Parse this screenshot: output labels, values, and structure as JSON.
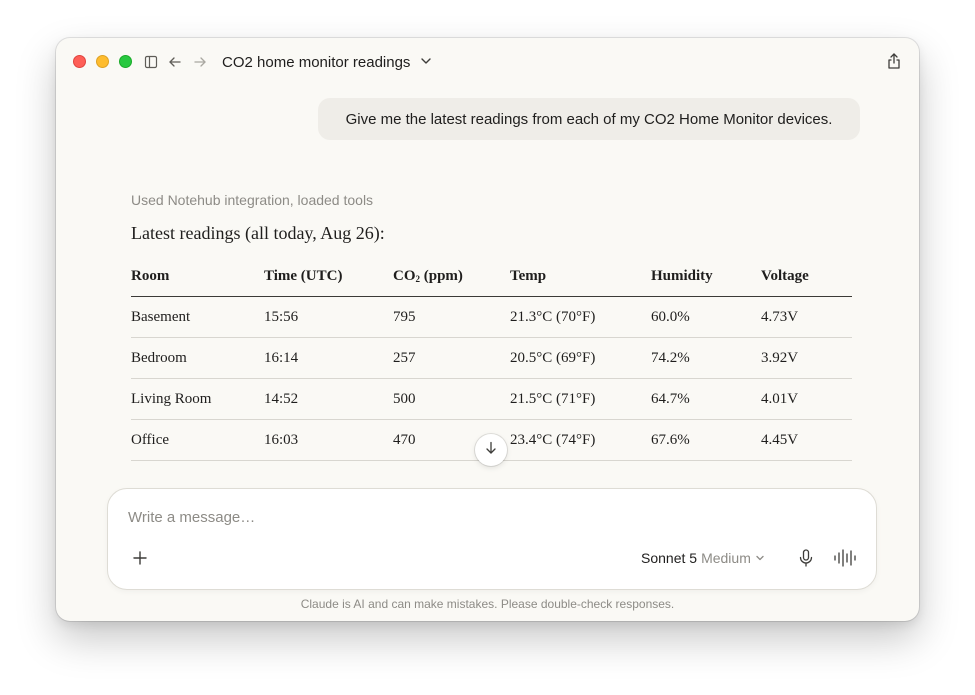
{
  "window": {
    "title": "CO2 home monitor readings"
  },
  "conversation": {
    "user_message": "Give me the latest readings from each of my CO2 Home Monitor devices.",
    "tool_note": "Used Notehub integration, loaded tools",
    "answer_intro": "Latest readings (all today, Aug 26):"
  },
  "table": {
    "headers": {
      "room": "Room",
      "time": "Time (UTC)",
      "co2_main": "CO",
      "co2_sub": "2",
      "co2_unit": " (ppm)",
      "temp": "Temp",
      "humidity": "Humidity",
      "voltage": "Voltage"
    },
    "rows": [
      {
        "room": "Basement",
        "time": "15:56",
        "co2": "795",
        "temp": "21.3°C (70°F)",
        "humidity": "60.0%",
        "voltage": "4.73V"
      },
      {
        "room": "Bedroom",
        "time": "16:14",
        "co2": "257",
        "temp": "20.5°C (69°F)",
        "humidity": "74.2%",
        "voltage": "3.92V"
      },
      {
        "room": "Living Room",
        "time": "14:52",
        "co2": "500",
        "temp": "21.5°C (71°F)",
        "humidity": "64.7%",
        "voltage": "4.01V"
      },
      {
        "room": "Office",
        "time": "16:03",
        "co2": "470",
        "temp": "23.4°C (74°F)",
        "humidity": "67.6%",
        "voltage": "4.45V"
      }
    ]
  },
  "composer": {
    "placeholder": "Write a message…",
    "model_name": "Sonnet 5",
    "model_effort": "Medium"
  },
  "footer": {
    "disclaimer": "Claude is AI and can make mistakes. Please double-check responses."
  },
  "icons": {
    "sidebar": "sidebar-icon",
    "back": "arrow-left-icon",
    "forward": "arrow-right-icon",
    "title_menu": "chevron-down-icon",
    "share": "share-icon",
    "scroll": "arrow-down-icon",
    "add": "plus-icon",
    "model_menu": "chevron-down-icon",
    "mic": "microphone-icon",
    "voice": "waveform-icon"
  },
  "colors": {
    "traffic_red": "#fe5f57",
    "traffic_yellow": "#febc2e",
    "traffic_green": "#28c840",
    "window_bg": "#faf9f5",
    "bubble_bg": "#efede8"
  }
}
